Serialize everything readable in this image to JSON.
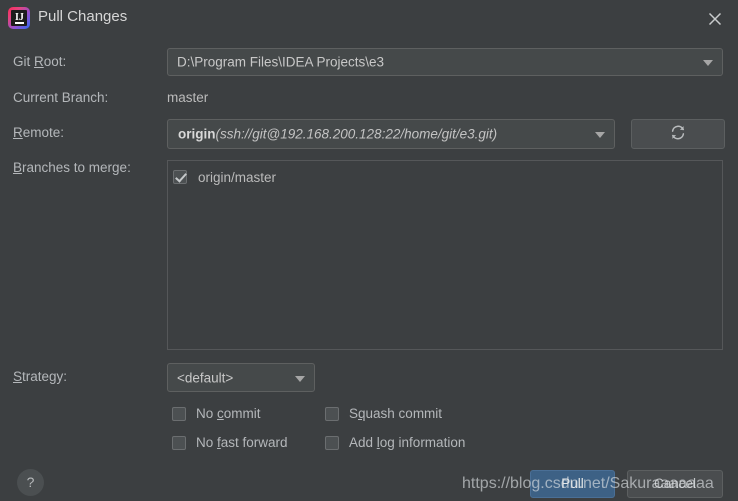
{
  "window": {
    "title": "Pull Changes",
    "app_icon": "intellij-idea-icon",
    "close_icon": "close-icon"
  },
  "form": {
    "git_root": {
      "label_prefix": "Git ",
      "label_mnemonic": "R",
      "label_suffix": "oot:",
      "value": "D:\\Program Files\\IDEA Projects\\e3"
    },
    "current_branch": {
      "label": "Current Branch:",
      "value": "master"
    },
    "remote": {
      "label_prefix": "",
      "label_mnemonic": "R",
      "label_suffix": "emote:",
      "name": "origin",
      "url": "(ssh://git@192.168.200.128:22/home/git/e3.git)",
      "refresh_icon": "refresh-icon"
    },
    "branches_to_merge": {
      "label_prefix": "",
      "label_mnemonic": "B",
      "label_suffix": "ranches to merge:",
      "items": [
        {
          "label": "origin/master",
          "checked": true
        }
      ]
    },
    "strategy": {
      "label_prefix": "",
      "label_mnemonic": "S",
      "label_suffix": "trategy:",
      "value": "<default>"
    },
    "options": [
      {
        "prefix": "No ",
        "mnemonic": "c",
        "suffix": "ommit",
        "checked": false
      },
      {
        "prefix": "S",
        "mnemonic": "q",
        "suffix": "uash commit",
        "checked": false
      },
      {
        "prefix": "No ",
        "mnemonic": "f",
        "suffix": "ast forward",
        "checked": false
      },
      {
        "prefix": "Add ",
        "mnemonic": "l",
        "suffix": "og information",
        "checked": false
      }
    ]
  },
  "footer": {
    "help_label": "?",
    "pull_label": "Pull",
    "cancel_label": "Cancel"
  },
  "watermark": {
    "text": "https://blog.csdn.net/Sakuraaaaaaa"
  },
  "colors": {
    "background": "#3c3f41",
    "field_background": "#45494a",
    "border": "#5e6060",
    "text": "#bbbbbb",
    "accent_button": "#3d6185"
  }
}
